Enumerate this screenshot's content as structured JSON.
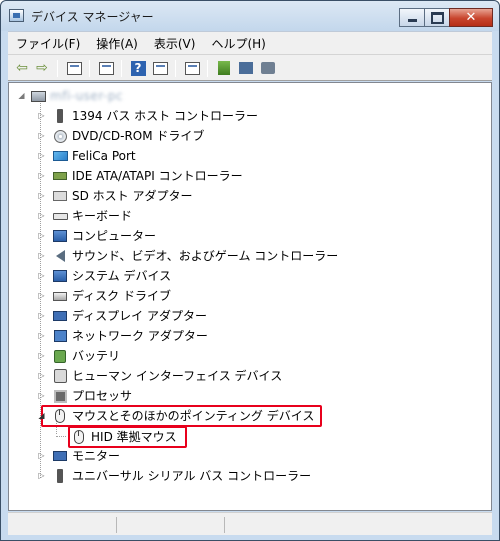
{
  "window": {
    "title": "デバイス マネージャー",
    "close_glyph": "✕"
  },
  "menu": [
    {
      "label": "ファイル(F)"
    },
    {
      "label": "操作(A)"
    },
    {
      "label": "表示(V)"
    },
    {
      "label": "ヘルプ(H)"
    }
  ],
  "toolbar": {
    "back_glyph": "⇦",
    "forward_glyph": "⇨",
    "help_glyph": "?"
  },
  "tree": {
    "root_label": "mfi-user-pc",
    "categories": [
      {
        "label": "1394 バス ホスト コントローラー",
        "icon": "usb-plug-icon"
      },
      {
        "label": "DVD/CD-ROM ドライブ",
        "icon": "disc-icon"
      },
      {
        "label": "FeliCa Port",
        "icon": "card-reader-icon"
      },
      {
        "label": "IDE ATA/ATAPI コントローラー",
        "icon": "ide-controller-icon"
      },
      {
        "label": "SD ホスト アダプター",
        "icon": "sd-card-icon"
      },
      {
        "label": "キーボード",
        "icon": "keyboard-icon"
      },
      {
        "label": "コンピューター",
        "icon": "computer-icon"
      },
      {
        "label": "サウンド、ビデオ、およびゲーム コントローラー",
        "icon": "speaker-icon"
      },
      {
        "label": "システム デバイス",
        "icon": "system-device-icon"
      },
      {
        "label": "ディスク ドライブ",
        "icon": "disk-drive-icon"
      },
      {
        "label": "ディスプレイ アダプター",
        "icon": "display-adapter-icon"
      },
      {
        "label": "ネットワーク アダプター",
        "icon": "network-adapter-icon"
      },
      {
        "label": "バッテリ",
        "icon": "battery-icon"
      },
      {
        "label": "ヒューマン インターフェイス デバイス",
        "icon": "hid-icon"
      },
      {
        "label": "プロセッサ",
        "icon": "processor-icon"
      },
      {
        "label": "マウスとそのほかのポインティング デバイス",
        "icon": "mouse-icon",
        "expanded": true
      },
      {
        "label": "HID 準拠マウス",
        "icon": "mouse-icon",
        "child": true
      },
      {
        "label": "モニター",
        "icon": "monitor-icon"
      },
      {
        "label": "ユニバーサル シリアル バス コントローラー",
        "icon": "usb-controller-icon"
      }
    ]
  },
  "colors": {
    "highlight": "#e8001c",
    "frame": "#c8dbef"
  }
}
